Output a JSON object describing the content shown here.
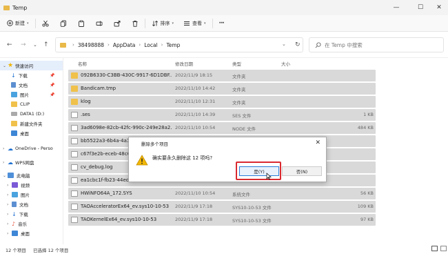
{
  "window": {
    "title": "Temp",
    "minimize": "—",
    "maximize": "☐",
    "close": "✕"
  },
  "ribbon": {
    "new_label": "新建",
    "sort_label": "排序",
    "view_label": "查看",
    "more_label": "···"
  },
  "address": {
    "crumbs": [
      "38498888",
      "AppData",
      "Local",
      "Temp"
    ],
    "search_placeholder": "在 Temp 中搜索"
  },
  "nav": {
    "quick_access": "快速访问",
    "items": [
      {
        "label": "下载",
        "pinned": true
      },
      {
        "label": "文档",
        "pinned": true
      },
      {
        "label": "图片",
        "pinned": true
      },
      {
        "label": "CLIP",
        "pinned": false
      },
      {
        "label": "DATA1 (D:)",
        "pinned": false
      },
      {
        "label": "新建文件夹",
        "pinned": false
      },
      {
        "label": "桌面",
        "pinned": false
      }
    ],
    "onedrive": "OneDrive - Perso",
    "wps": "WPS网盘",
    "this_pc": "此电脑",
    "pc_items": [
      "视频",
      "图片",
      "文档",
      "下载",
      "音乐",
      "桌面"
    ]
  },
  "columns": {
    "name": "名称",
    "date": "修改日期",
    "type": "类型",
    "size": "大小"
  },
  "files": [
    {
      "name": "092B6330-C3BB-430C-9917-6D1DBF...",
      "date": "2022/11/9 18:15",
      "type": "文件夹",
      "size": "",
      "kind": "folder"
    },
    {
      "name": "Bandicam.tmp",
      "date": "2022/11/10 14:42",
      "type": "文件夹",
      "size": "",
      "kind": "folder"
    },
    {
      "name": "klog",
      "date": "2022/11/10 12:31",
      "type": "文件夹",
      "size": "",
      "kind": "folder"
    },
    {
      "name": ".ses",
      "date": "2022/11/10 14:39",
      "type": "SES 文件",
      "size": "1 KB",
      "kind": "file"
    },
    {
      "name": "3ad6098e-82cb-42fc-990c-249e28a2...",
      "date": "2022/11/10 10:54",
      "type": "NODE 文件",
      "size": "484 KB",
      "kind": "file"
    },
    {
      "name": "bb5522a3-6b4a-4a18",
      "date": "",
      "type": "",
      "size": "",
      "kind": "file"
    },
    {
      "name": "c67f3e2b-eceb-48c6",
      "date": "",
      "type": "",
      "size": "",
      "kind": "file"
    },
    {
      "name": "cv_debug.log",
      "date": "",
      "type": "",
      "size": "",
      "kind": "file"
    },
    {
      "name": "ea1cbc1f-fb23-44ed-",
      "date": "",
      "type": "",
      "size": "",
      "kind": "file"
    },
    {
      "name": "HWiNFO64A_172.SYS",
      "date": "2022/11/10 10:54",
      "type": "系统文件",
      "size": "56 KB",
      "kind": "file"
    },
    {
      "name": "TAOAcceleratorEx64_ev.sys10-10-53",
      "date": "2022/11/9 17:18",
      "type": "SYS10-10-53 文件",
      "size": "109 KB",
      "kind": "file"
    },
    {
      "name": "TAOKernelEx64_ev.sys10-10-53",
      "date": "2022/11/9 17:18",
      "type": "SYS10-10-53 文件",
      "size": "97 KB",
      "kind": "file"
    }
  ],
  "status": {
    "count": "12 个项目",
    "selected": "已选择 12 个项目"
  },
  "dialog": {
    "title": "删除多个项目",
    "message": "确实要永久删除这 12 项吗?",
    "yes": "是(Y)",
    "no": "否(N)",
    "close": "✕"
  }
}
